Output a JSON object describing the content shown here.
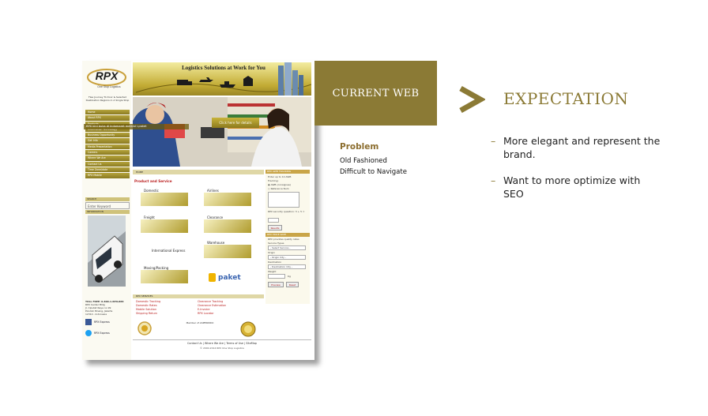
{
  "slide": {
    "current_label": "CURRENT WEB",
    "expectation_label": "EXPECTATION",
    "accent_color": "#8b7a35",
    "problem": {
      "title": "Problem",
      "items": [
        "Old Fashioned",
        "Difficult to Navigate"
      ]
    },
    "expectations": [
      "More elegant and represent the brand.",
      "Want to more optimize with SEO"
    ]
  },
  "website": {
    "logo_text": "RPX",
    "logo_sub": "One Stop Logistics",
    "tagline": "Flea Journey To Door & Selected Destination Regions in A Single Stop",
    "banner_title": "Logistics Solutions at Work for You",
    "nav": [
      "Home",
      "About RPX",
      "Products",
      "Information Technology",
      "Business Opportunity",
      "Get Info",
      "Media Presentation",
      "Careers",
      "Where We Are",
      "Contact Us",
      "Time Zone/date",
      "RPX Mobile"
    ],
    "search_label": "SEARCH",
    "keyword_placeholder": "Enter Keyword",
    "information_label": "INFORMATION",
    "hero_caption": "RPX kini buka di Indomaret melalui i-paket",
    "hero_button": "Click here for details",
    "breadcrumb": "HOME",
    "section_title": "Product and Service",
    "services": [
      {
        "name": "Domestic"
      },
      {
        "name": "Airlines"
      },
      {
        "name": "Freight"
      },
      {
        "name": "Clearance"
      },
      {
        "name": "International Express"
      },
      {
        "name": "Warehouse"
      },
      {
        "name": "Moving/Packing"
      }
    ],
    "paket_text": "paket",
    "contact_lines": [
      "TOLL FREE: 0-800-1-RPX-888",
      "RPX Center Bldg",
      "Jl. Ciputat Raya no 99",
      "Pondok Pinang, Jakarta",
      "12310 - Indonesia"
    ],
    "social": [
      "RPX Express",
      "RPX Express"
    ],
    "tracking": {
      "title": "RPX AWB TRACKING",
      "hint": "Enter up to 10 AWB",
      "tracking_label": "Tracking:",
      "option_1": "AWB (consignee)",
      "option_2": "Reference Num",
      "security_label": "RPX security question: 3 + 5 =",
      "button": "Results"
    },
    "rate": {
      "title": "RPX PRICE RATE",
      "hint": "RPX provides quality rates",
      "service_label": "Service Types",
      "service_value": "- Select Service -",
      "origin_label": "Origin",
      "origin_value": "- Origin City -",
      "destination_label": "Destination",
      "destination_value": "- Destination City -",
      "weight_label": "Weight",
      "weight_unit": "Kg",
      "preview_button": "Preview",
      "reset_button": "Reset"
    },
    "links_header": "RPX SERVICES",
    "links_left": [
      "Domestic Tracking",
      "Domestic Rates",
      "Mobile Solution",
      "Shipping Return"
    ],
    "links_right": [
      "Clearance Tracking",
      "Clearance Estimation",
      "E-Invoice",
      "RPX Locator"
    ],
    "partner_label": "Member of ASPERINDO",
    "footer_nav": "Contact Us  |  Where We Are  |  Terms of Use  |  SiteMap",
    "footer_copy": "© 2000-2014 RPX One Stop Logistics"
  }
}
